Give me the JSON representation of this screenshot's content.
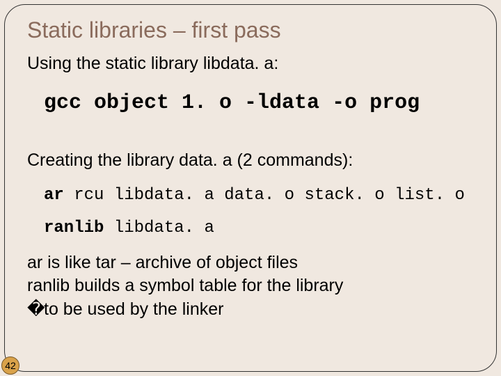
{
  "title": "Static libraries – first pass",
  "using_line": "Using the static library libdata. a:",
  "cmd_use": "gcc object 1. o -ldata -o prog",
  "creating_line": "Creating the library data. a (2 commands):",
  "cmd_ar_kw": "ar",
  "cmd_ar_rest": " rcu libdata. a data. o stack. o list. o",
  "cmd_ranlib_kw": "ranlib",
  "cmd_ranlib_rest": " libdata. a",
  "desc1": "ar is like tar – archive of object files",
  "desc2": "ranlib builds a symbol table for the library",
  "desc3_glyph": "�",
  "desc3_rest": "to be used by the linker",
  "slide_number": "42"
}
